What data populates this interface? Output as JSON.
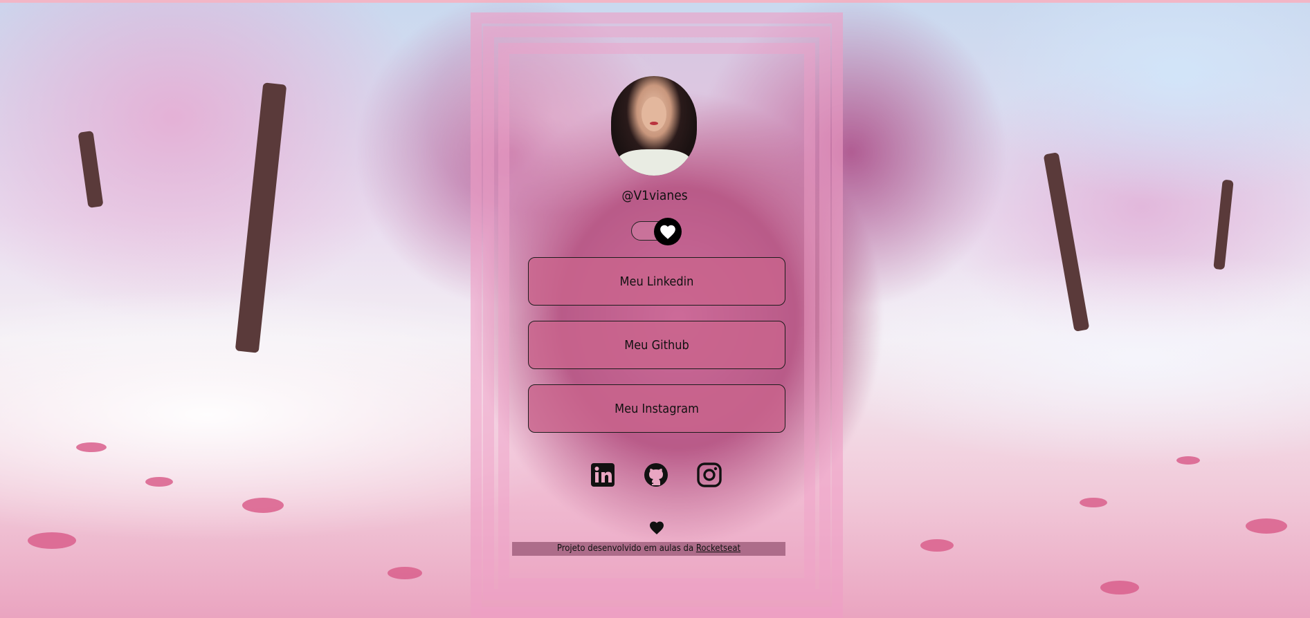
{
  "profile": {
    "handle": "@V1vianes",
    "avatar_alt": "avatar"
  },
  "toggle": {
    "icon": "heart-icon",
    "state": "on"
  },
  "links": [
    {
      "label": "Meu Linkedin"
    },
    {
      "label": "Meu Github"
    },
    {
      "label": "Meu Instagram"
    }
  ],
  "social_icons": [
    "linkedin-icon",
    "github-icon",
    "instagram-icon"
  ],
  "footer": {
    "text": "Projeto desenvolvido em aulas da",
    "link_label": "Rocketseat"
  },
  "colors": {
    "button_bg": "#c9648c",
    "frame": "#f0a0c8",
    "text": "#111111"
  }
}
